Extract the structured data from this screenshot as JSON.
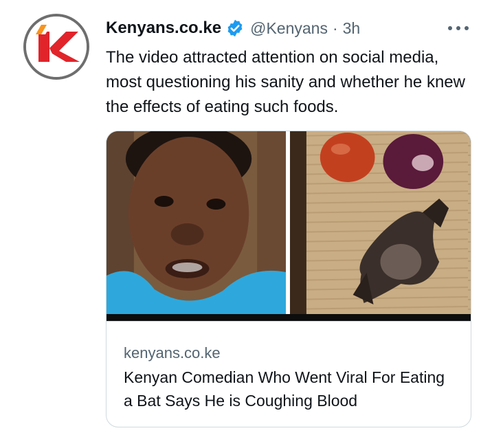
{
  "tweet": {
    "author_name": "Kenyans.co.ke",
    "handle": "@Kenyans",
    "separator": "·",
    "time": "3h",
    "text": "The video attracted attention on social media, most questioning his sanity and whether he knew the effects of eating such foods.",
    "icons": {
      "avatar": "kenyans-logo-avatar",
      "verified": "verified-badge-icon",
      "more": "more-options-icon"
    }
  },
  "card": {
    "domain": "kenyans.co.ke",
    "title": "Kenyan Comedian Who Went Viral For Eating a Bat Says He is Coughing Blood",
    "image": "composite photo: man in blue shirt; bat with tomato and red onion on wooden board"
  },
  "colors": {
    "verified": "#1d9bf0",
    "secondary_text": "#536471",
    "border": "#cfd9de",
    "logo_red": "#e0242a",
    "logo_orange": "#f7941d"
  }
}
